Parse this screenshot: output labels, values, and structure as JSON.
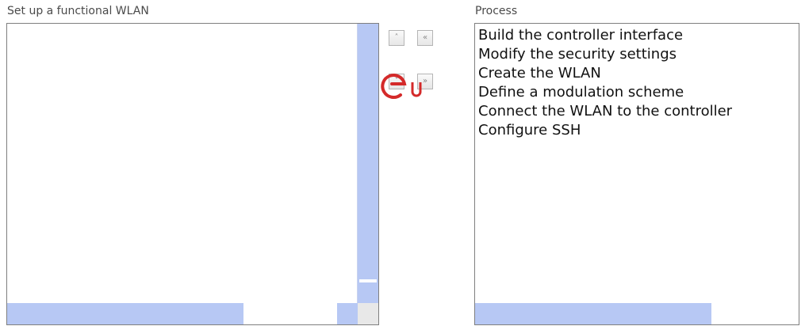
{
  "left_panel": {
    "caption": "Set up a functional WLAN",
    "items": []
  },
  "right_panel": {
    "caption": "Process",
    "items": [
      "Build the controller interface",
      "Modify the security settings",
      "Create the WLAN",
      "Define a modulation scheme",
      "Connect the WLAN to the controller",
      "Configure SSH"
    ]
  },
  "buttons": {
    "up": "˄",
    "move_left": "«",
    "down": "˅",
    "move_right": "»"
  },
  "icons": {
    "up": "chevron-up-icon",
    "move_left": "double-chevron-left-icon",
    "down": "chevron-down-icon",
    "move_right": "double-chevron-right-icon"
  },
  "colors": {
    "scrollbar": "#b7c8f4",
    "border": "#7f7f7f",
    "watermark": "#d42a2a"
  }
}
